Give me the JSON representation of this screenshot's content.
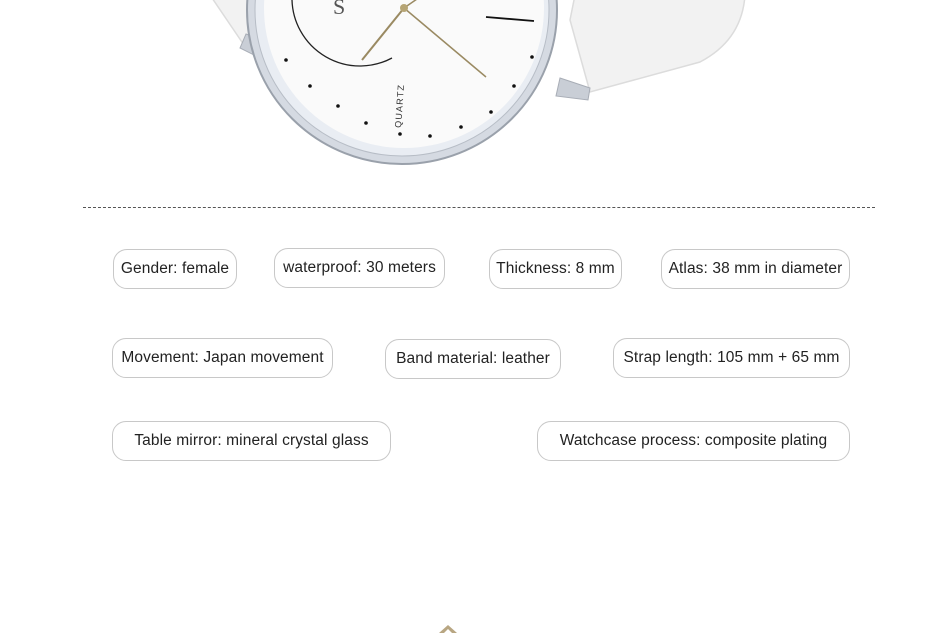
{
  "watch": {
    "dial_text": "QUARTZ",
    "logo_letter": "S"
  },
  "specs": [
    {
      "label": "Gender: female"
    },
    {
      "label": "waterproof: 30 meters"
    },
    {
      "label": "Thickness: 8 mm"
    },
    {
      "label": "Atlas: 38 mm in diameter"
    },
    {
      "label": "Movement: Japan movement"
    },
    {
      "label": "Band material: leather"
    },
    {
      "label": "Strap length: 105 mm + 65 mm"
    },
    {
      "label": "Table mirror: mineral crystal glass"
    },
    {
      "label": "Watchcase process: composite plating"
    }
  ],
  "colors": {
    "border": "#c8c8c8",
    "text": "#222222",
    "divider": "#555555",
    "watch_case": "#b9bfc8",
    "strap": "#f1f1f1"
  }
}
